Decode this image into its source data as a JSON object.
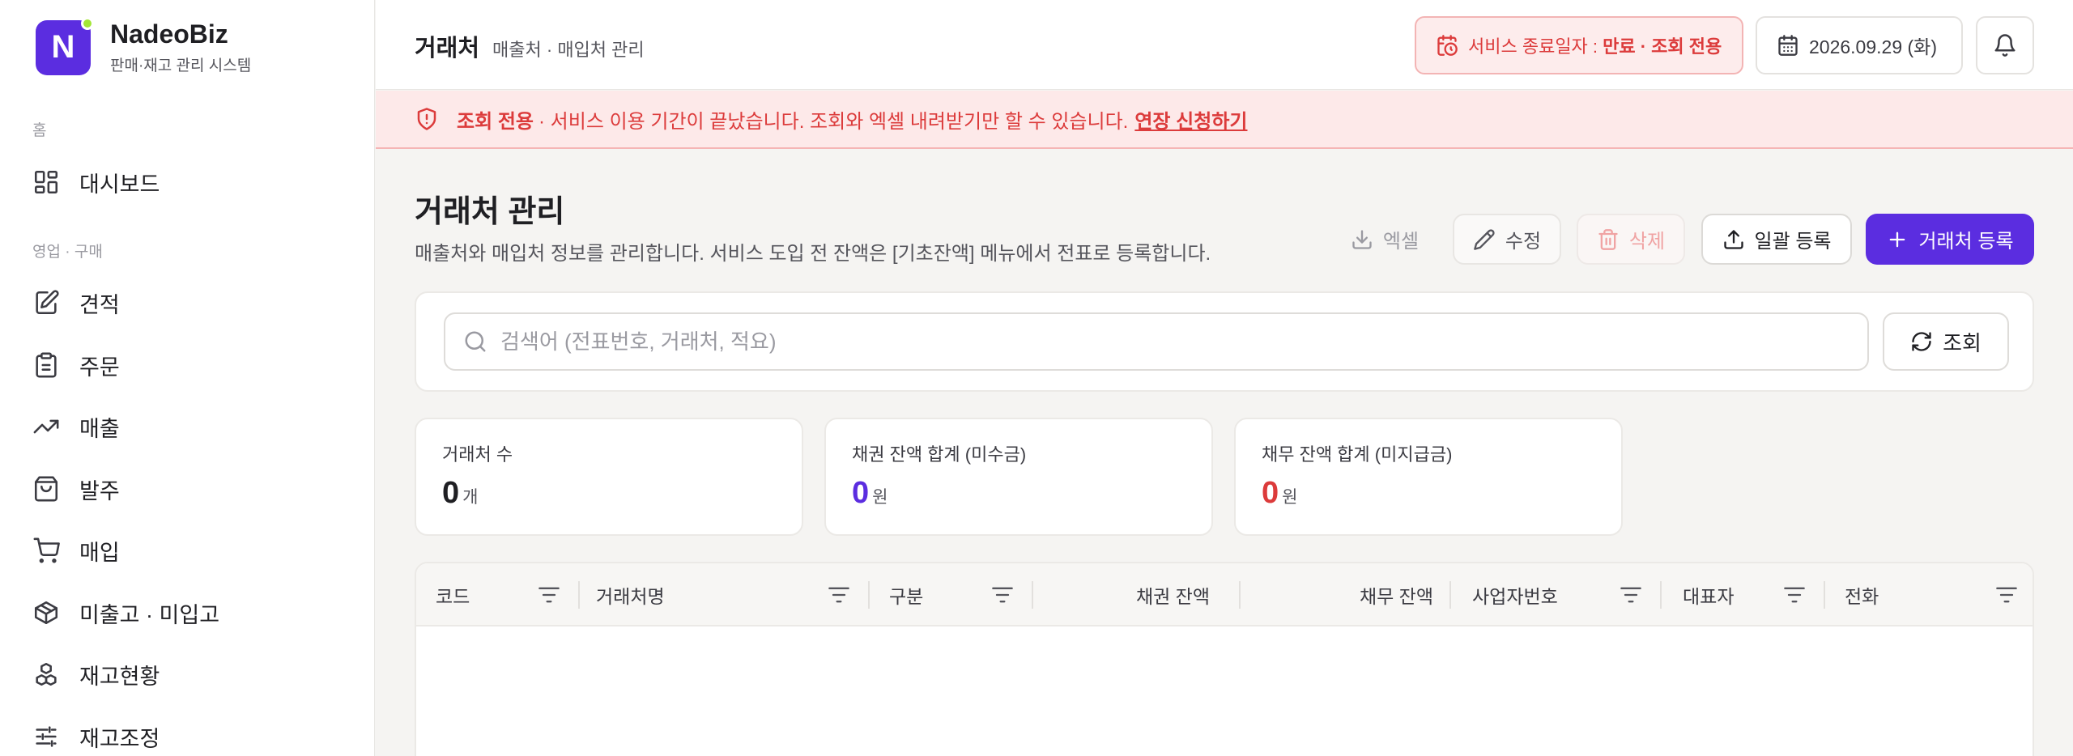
{
  "brand": {
    "name": "NadeoBiz",
    "subtitle": "판매·재고 관리 시스템",
    "logo_letter": "N"
  },
  "sidebar": {
    "sections": [
      "홈",
      "영업 · 구매"
    ],
    "items": [
      {
        "label": "대시보드",
        "icon": "dashboard-icon"
      },
      {
        "label": "견적",
        "icon": "quote-edit-icon"
      },
      {
        "label": "주문",
        "icon": "clipboard-icon"
      },
      {
        "label": "매출",
        "icon": "trend-up-icon"
      },
      {
        "label": "발주",
        "icon": "shopping-bag-icon"
      },
      {
        "label": "매입",
        "icon": "cart-icon"
      },
      {
        "label": "미출고 · 미입고",
        "icon": "package-icon"
      },
      {
        "label": "재고현황",
        "icon": "boxes-icon"
      },
      {
        "label": "재고조정",
        "icon": "sliders-icon"
      }
    ]
  },
  "header": {
    "title": "거래처",
    "subtitle": "매출처 · 매입처 관리",
    "service_prefix": "서비스 종료일자 : ",
    "service_status": "만료 · 조회 전용",
    "date": "2026.09.29 (화)"
  },
  "alert": {
    "strong": "조회 전용",
    "text": "· 서비스 이용 기간이 끝났습니다. 조회와 엑셀 내려받기만 할 수 있습니다.",
    "link": "연장 신청하기"
  },
  "main": {
    "title": "거래처 관리",
    "description": "매출처와 매입처 정보를 관리합니다. 서비스 도입 전 잔액은 [기초잔액] 메뉴에서 전표로 등록합니다.",
    "buttons": {
      "excel": "엑셀",
      "edit": "수정",
      "delete": "삭제",
      "bulk": "일괄 등록",
      "add": "거래처 등록"
    },
    "search": {
      "placeholder": "검색어 (전표번호, 거래처, 적요)",
      "value": "",
      "query_label": "조회"
    },
    "stats": [
      {
        "label": "거래처 수",
        "value": "0",
        "unit": "개",
        "color": "#1f1f23"
      },
      {
        "label": "채권 잔액 합계 (미수금)",
        "value": "0",
        "unit": "원",
        "color": "#5b2de0"
      },
      {
        "label": "채무 잔액 합계 (미지급금)",
        "value": "0",
        "unit": "원",
        "color": "#dc3b3b"
      }
    ],
    "table": {
      "columns": [
        "코드",
        "거래처명",
        "구분",
        "채권 잔액",
        "채무 잔액",
        "사업자번호",
        "대표자",
        "전화"
      ]
    }
  },
  "colors": {
    "brand": "#5b2de0",
    "danger": "#dc3b3b",
    "logo_dot": "#a3e635"
  }
}
